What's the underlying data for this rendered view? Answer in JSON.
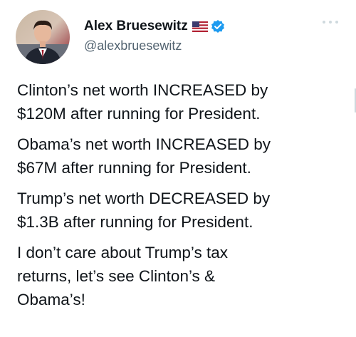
{
  "author": {
    "display_name": "Alex Bruesewitz",
    "handle": "@alexbruesewitz",
    "flag_icon": "us-flag-icon",
    "verified_icon": "verified-badge-icon"
  },
  "tweet": {
    "paragraphs": [
      "Clinton’s net worth INCREASED by\n$120M after running for President.",
      "Obama’s net worth INCREASED by\n$67M after running for President.",
      "Trump’s net worth DECREASED by\n$1.3B after running for President.",
      "I don’t care about Trump’s tax\nreturns, let’s see Clinton’s &\nObama’s!"
    ]
  },
  "colors": {
    "text": "#0f1419",
    "secondary_text": "#536471",
    "verified_blue": "#1d9bf0"
  }
}
